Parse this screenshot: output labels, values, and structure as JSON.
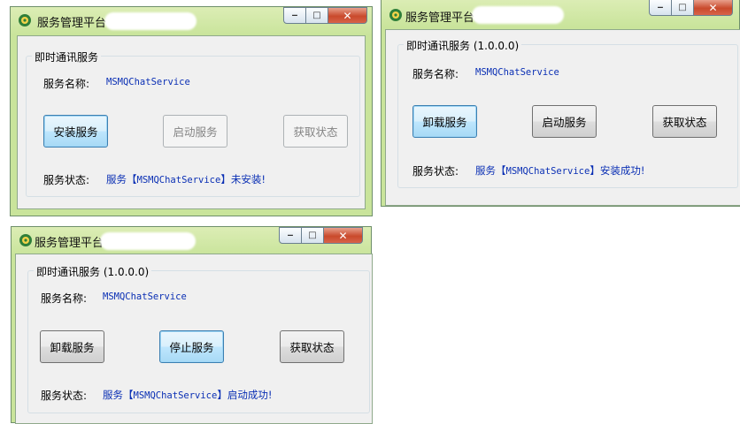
{
  "app_title": "服务管理平台",
  "window_controls": {
    "minimize": "‒",
    "maximize": "□",
    "close": "✕"
  },
  "windows": [
    {
      "group_title": "即时通讯服务",
      "name_label": "服务名称:",
      "name_value": "MSMQChatService",
      "buttons": [
        {
          "label": "安装服务",
          "state": "focused"
        },
        {
          "label": "启动服务",
          "state": "disabled"
        },
        {
          "label": "获取状态",
          "state": "disabled"
        }
      ],
      "status_label": "服务状态:",
      "status_prefix": "服务【",
      "status_service": "MSMQChatService",
      "status_suffix": "】未安装!"
    },
    {
      "group_title": "即时通讯服务 (1.0.0.0)",
      "name_label": "服务名称:",
      "name_value": "MSMQChatService",
      "buttons": [
        {
          "label": "卸载服务",
          "state": "focused"
        },
        {
          "label": "启动服务",
          "state": "normal"
        },
        {
          "label": "获取状态",
          "state": "normal"
        }
      ],
      "status_label": "服务状态:",
      "status_prefix": "服务【",
      "status_service": "MSMQChatService",
      "status_suffix": "】安装成功!"
    },
    {
      "group_title": "即时通讯服务 (1.0.0.0)",
      "name_label": "服务名称:",
      "name_value": "MSMQChatService",
      "buttons": [
        {
          "label": "卸载服务",
          "state": "normal"
        },
        {
          "label": "停止服务",
          "state": "focused"
        },
        {
          "label": "获取状态",
          "state": "normal"
        }
      ],
      "status_label": "服务状态:",
      "status_prefix": "服务【",
      "status_service": "MSMQChatService",
      "status_suffix": "】启动成功!"
    }
  ],
  "colors": {
    "title_bar": "#c9e49b",
    "value_text": "#0a2fb4",
    "close_button": "#c94a2c"
  }
}
